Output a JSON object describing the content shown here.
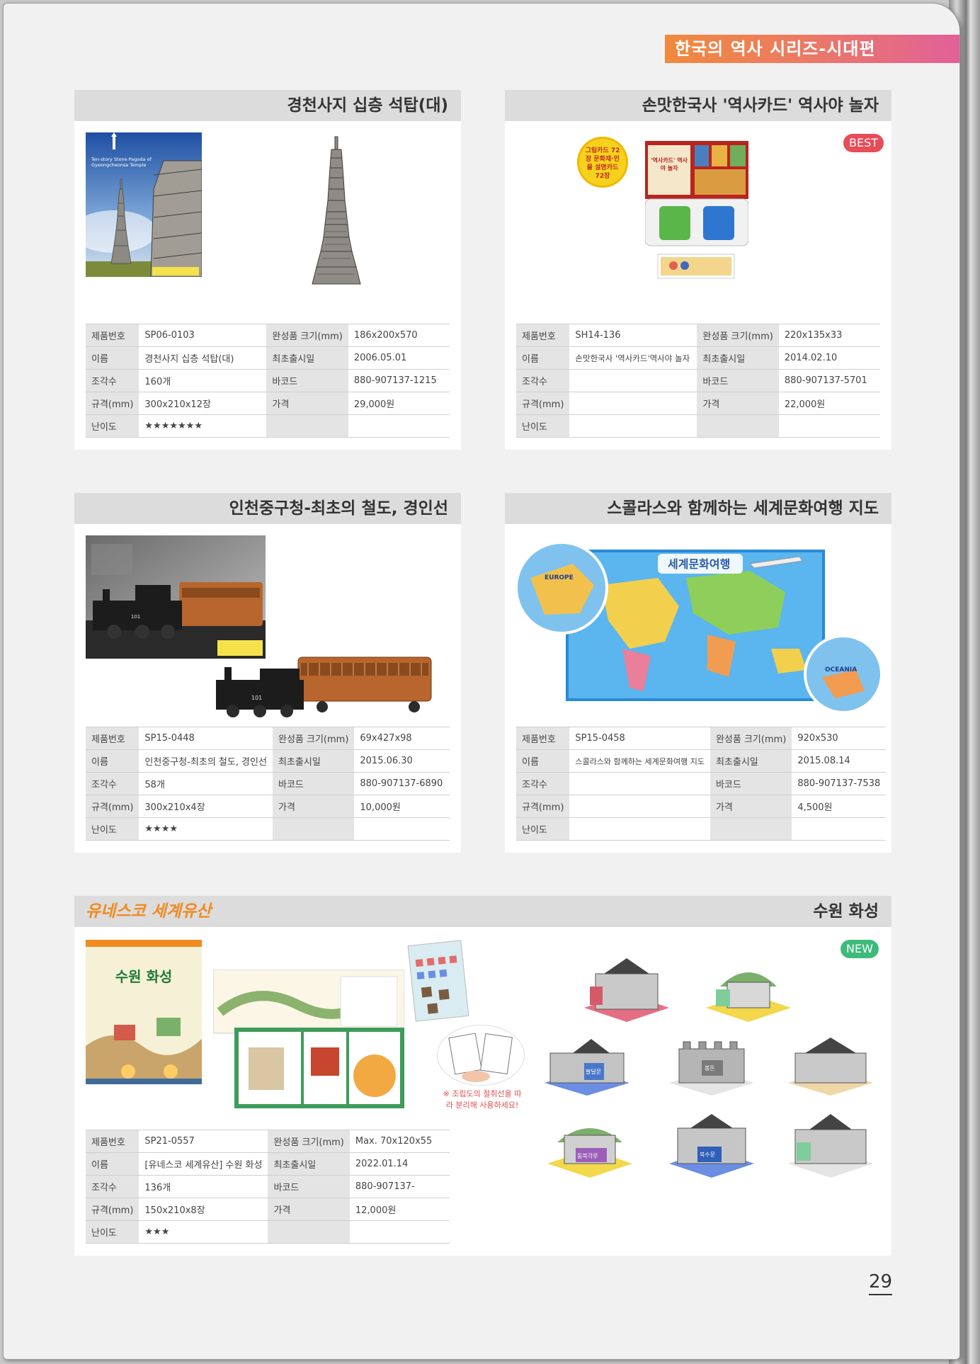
{
  "series_title": "한국의 역사 시리즈-시대편",
  "page_number": "29",
  "spec_keys": {
    "code": "제품번호",
    "name": "이름",
    "pieces": "조각수",
    "size": "규격(mm)",
    "difficulty": "난이도",
    "finished": "완성품 크기(mm)",
    "release": "최초출시일",
    "barcode": "바코드",
    "price": "가격"
  },
  "products": [
    {
      "title": "경천사지 십층 석탑(대)",
      "code": "SP06-0103",
      "name": "경천사지 십층 석탑(대)",
      "pieces": "160개",
      "size": "300x210x12장",
      "difficulty": "★★★★★★★",
      "finished": "186x200x570",
      "release": "2006.05.01",
      "barcode": "880-907137-1215",
      "price": "29,000원",
      "box_caption": "Ten-story Stone Pagoda of Gyeongcheonsa Temple"
    },
    {
      "title": "손맛한국사 '역사카드' 역사야 놀자",
      "badge": "BEST",
      "code": "SH14-136",
      "name": "손맛한국사 '역사카드'역사야 놀자",
      "pieces": "",
      "size": "",
      "difficulty": "",
      "finished": "220x135x33",
      "release": "2014.02.10",
      "barcode": "880-907137-5701",
      "price": "22,000원",
      "sticker": "그림카드 72장 문화재·인물 설명카드 72장",
      "box_title": "'역사카드' 역사야 놀자"
    },
    {
      "title": "인천중구청-최초의 철도, 경인선",
      "code": "SP15-0448",
      "name": "인천중구청-최초의 철도, 경인선",
      "pieces": "58개",
      "size": "300x210x4장",
      "difficulty": "★★★★",
      "finished": "69x427x98",
      "release": "2015.06.30",
      "barcode": "880-907137-6890",
      "price": "10,000원",
      "train_number": "101"
    },
    {
      "title": "스콜라스와 함께하는 세계문화여행 지도",
      "code": "SP15-0458",
      "name": "스콜라스와 함께하는 세계문화여행 지도",
      "pieces": "",
      "size": "",
      "difficulty": "",
      "finished": "920x530",
      "release": "2015.08.14",
      "barcode": "880-907137-7538",
      "price": "4,500원",
      "map_title": "세계문화여행",
      "map_labels": [
        "EUROPE",
        "OCEANIA"
      ]
    },
    {
      "title": "수원 화성",
      "tag": "유네스코 세계유산",
      "badge": "NEW",
      "code": "SP21-0557",
      "name": "[유네스코 세계유산] 수원 화성",
      "pieces": "136개",
      "size": "150x210x8장",
      "difficulty": "★★★",
      "finished": "Max. 70x120x55",
      "release": "2022.01.14",
      "barcode": "880-907137-",
      "price": "12,000원",
      "box_title": "수원 화성",
      "note": "※ 조립도의 절취선을 따라 분리해 사용하세요!",
      "model_labels": [
        "팔달문",
        "봉돈",
        "동북각루",
        "북수문"
      ]
    }
  ]
}
